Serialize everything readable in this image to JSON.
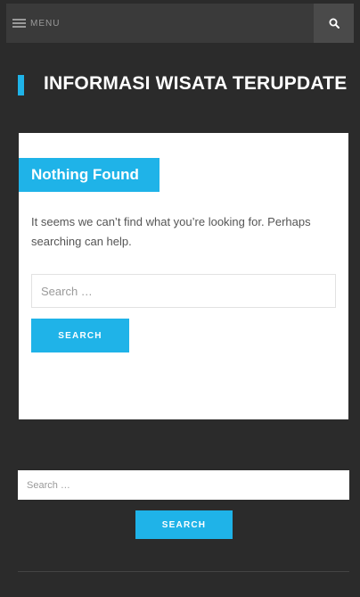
{
  "header": {
    "menu_label": "MENU",
    "search_icon": "search-icon"
  },
  "site": {
    "title": "INFORMASI WISATA TERUPDATE",
    "accent_color": "#1fb3e8"
  },
  "content": {
    "heading": "Nothing Found",
    "message": "It seems we can’t find what you’re looking for. Perhaps searching can help.",
    "search": {
      "placeholder": "Search …",
      "button_label": "SEARCH"
    }
  },
  "sidebar_search": {
    "placeholder": "Search …",
    "button_label": "SEARCH"
  }
}
